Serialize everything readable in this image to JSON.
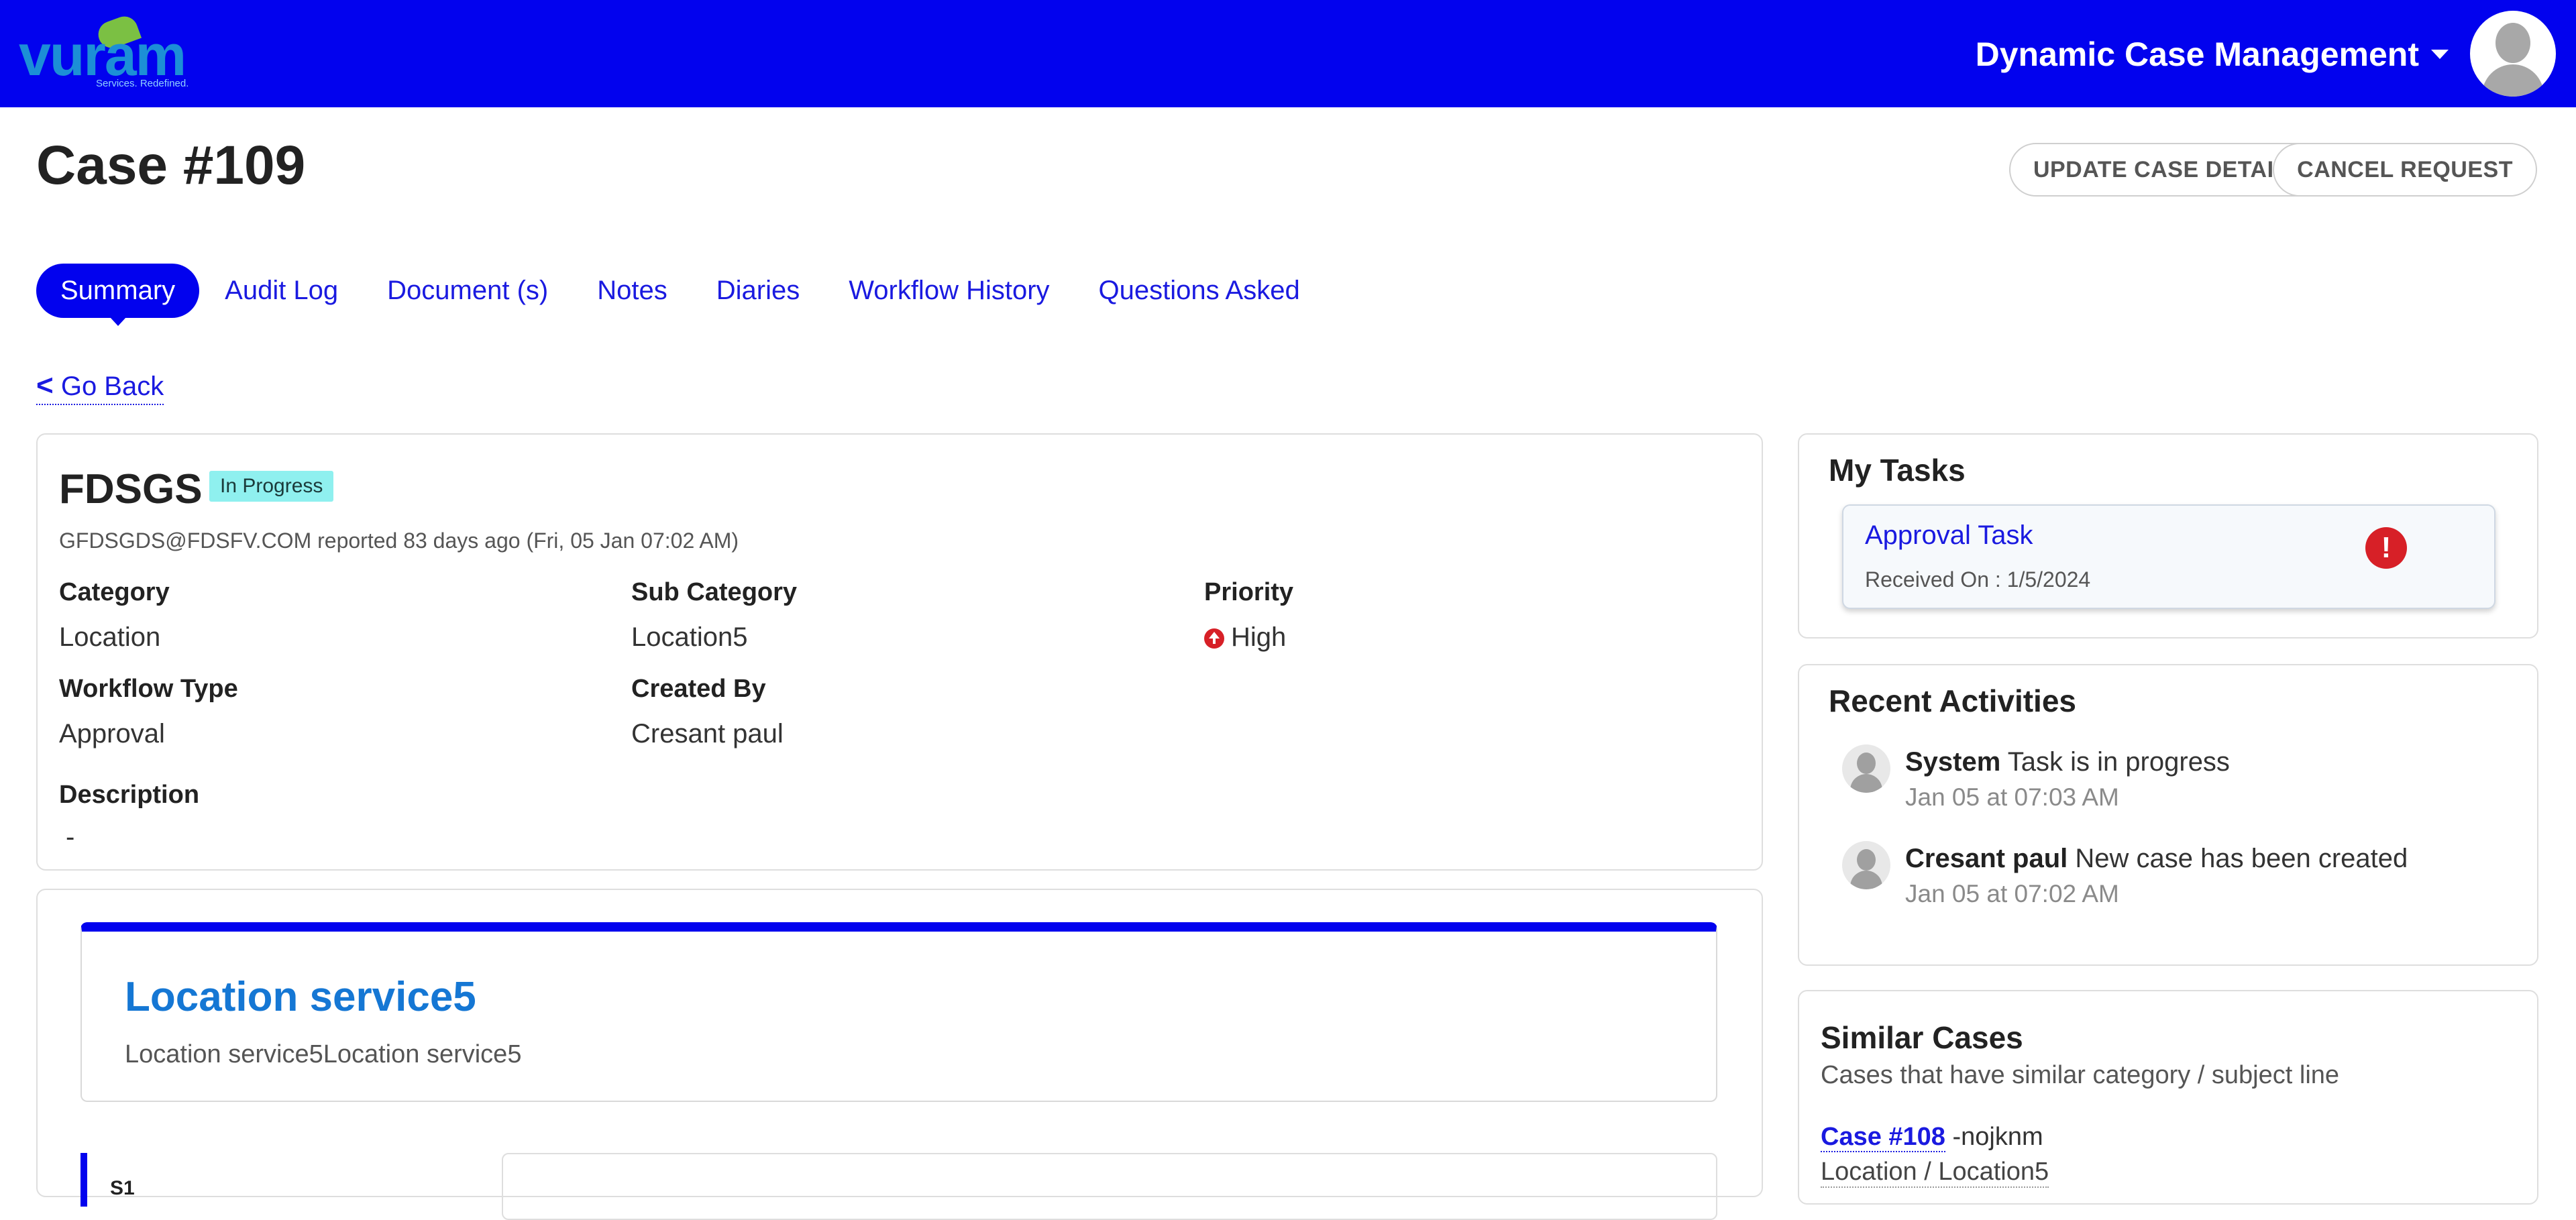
{
  "header": {
    "logo_text": "vuram",
    "logo_tagline": "Services. Redefined.",
    "app_name": "Dynamic Case Management",
    "brand_color": "#0202ee"
  },
  "case": {
    "title": "Case #109",
    "actions": {
      "update": "UPDATE CASE DETAILS",
      "cancel": "CANCEL REQUEST"
    }
  },
  "tabs": [
    {
      "label": "Summary",
      "active": true
    },
    {
      "label": "Audit Log"
    },
    {
      "label": "Document (s)"
    },
    {
      "label": "Notes"
    },
    {
      "label": "Diaries"
    },
    {
      "label": "Workflow History"
    },
    {
      "label": "Questions Asked"
    }
  ],
  "go_back": "Go Back",
  "summary": {
    "subject": "FDSGS",
    "status": "In Progress",
    "reporter": "GFDSGDS@FDSFV.COM reported 83 days ago (Fri, 05 Jan 07:02 AM)",
    "category_label": "Category",
    "category": "Location",
    "sub_category_label": "Sub Category",
    "sub_category": "Location5",
    "priority_label": "Priority",
    "priority": "High",
    "workflow_type_label": "Workflow Type",
    "workflow_type": "Approval",
    "created_by_label": "Created By",
    "created_by": "Cresant paul",
    "description_label": "Description",
    "description": "-"
  },
  "service": {
    "title": "Location service5",
    "description": "Location service5Location service5",
    "section_label": "S1"
  },
  "my_tasks": {
    "title": "My Tasks",
    "items": [
      {
        "name": "Approval Task",
        "received": "Received On : 1/5/2024",
        "alert": "!"
      }
    ]
  },
  "recent_activities": {
    "title": "Recent Activities",
    "items": [
      {
        "actor": "System",
        "text": " Task is in progress",
        "time": "Jan 05 at 07:03 AM"
      },
      {
        "actor": "Cresant paul",
        "text": " New case has been created",
        "time": "Jan 05 at 07:02 AM"
      }
    ]
  },
  "similar_cases": {
    "title": "Similar Cases",
    "subtitle": "Cases that have similar category / subject line",
    "items": [
      {
        "case": "Case #108",
        "suffix": " -nojknm",
        "location": "Location / Location5"
      }
    ]
  }
}
